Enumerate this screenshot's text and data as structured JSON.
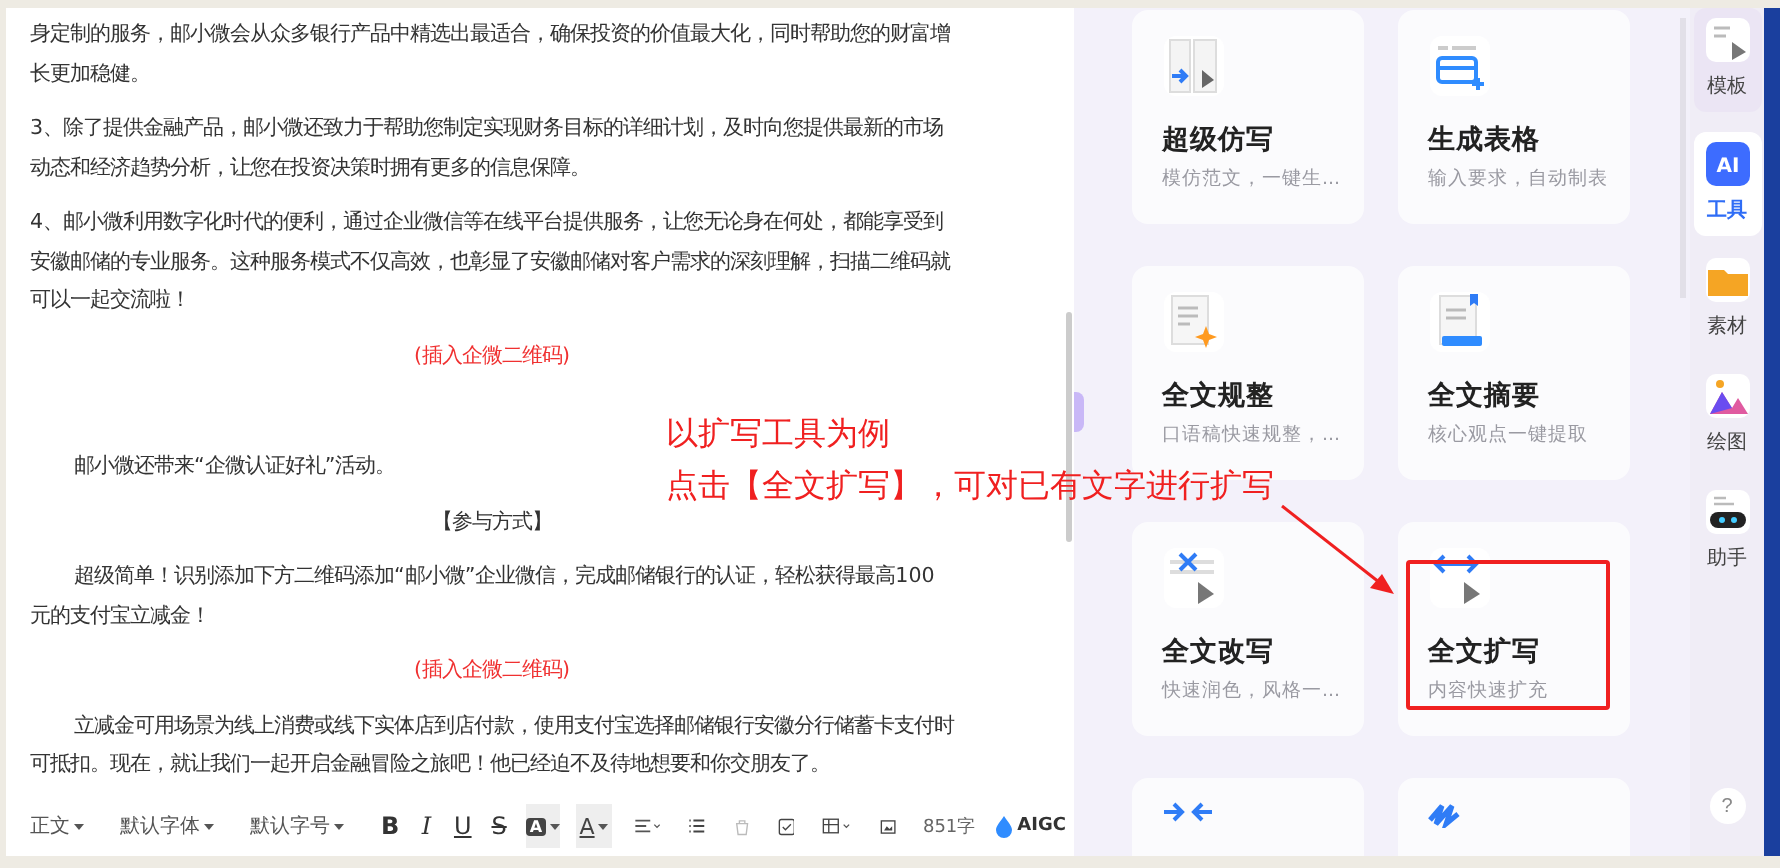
{
  "editor": {
    "paragraphs": [
      {
        "kind": "text",
        "text": "身定制的服务，邮小微会从众多银行产品中精选出最适合，确保投资的价值最大化，同时帮助您的财富增长更加稳健。"
      },
      {
        "kind": "text",
        "text": "3、除了提供金融产品，邮小微还致力于帮助您制定实现财务目标的详细计划，及时向您提供最新的市场动态和经济趋势分析，让您在投资决策时拥有更多的信息保障。"
      },
      {
        "kind": "text",
        "text": "4、邮小微利用数字化时代的便利，通过企业微信等在线平台提供服务，让您无论身在何处，都能享受到安徽邮储的专业服务。这种服务模式不仅高效，也彰显了安徽邮储对客户需求的深刻理解，扫描二维码就可以一起交流啦！"
      },
      {
        "kind": "note",
        "text": "(插入企微二维码)"
      },
      {
        "kind": "indented",
        "text": "邮小微还带来“企微认证好礼”活动。"
      },
      {
        "kind": "centered",
        "text": "【参与方式】"
      },
      {
        "kind": "indented",
        "text": "超级简单！识别添加下方二维码添加“邮小微”企业微信，完成邮储银行的认证，轻松获得最高100元的支付宝立减金！"
      },
      {
        "kind": "note",
        "text": "(插入企微二维码)"
      },
      {
        "kind": "indented",
        "text": "立减金可用场景为线上消费或线下实体店到店付款，使用支付宝选择邮储银行安徽分行储蓄卡支付时可抵扣。现在，就让我们一起开启金融冒险之旅吧！他已经迫不及待地想要和你交朋友了。"
      }
    ]
  },
  "toolbar": [
    {
      "kind": "dropdown",
      "label": "正文"
    },
    {
      "kind": "dropdown",
      "label": "默认字体"
    },
    {
      "kind": "dropdown",
      "label": "默认字号"
    },
    {
      "kind": "bold",
      "label": "B"
    },
    {
      "kind": "italic",
      "label": "I"
    },
    {
      "kind": "underline",
      "label": "U"
    },
    {
      "kind": "strike",
      "label": "S"
    },
    {
      "kind": "highlight",
      "label": "A"
    },
    {
      "kind": "color",
      "label": "A"
    },
    {
      "kind": "align"
    },
    {
      "kind": "list"
    },
    {
      "kind": "eraser"
    },
    {
      "kind": "checkbox"
    },
    {
      "kind": "table"
    },
    {
      "kind": "image"
    },
    {
      "kind": "count",
      "label": "851字"
    },
    {
      "kind": "aigc",
      "label": "AIGC"
    }
  ],
  "tools": [
    {
      "title": "超级仿写",
      "subtitle": "模仿范文，一键生..."
    },
    {
      "title": "生成表格",
      "subtitle": "输入要求，自动制表"
    },
    {
      "title": "全文规整",
      "subtitle": "口语稿快速规整，..."
    },
    {
      "title": "全文摘要",
      "subtitle": "核心观点一键提取"
    },
    {
      "title": "全文改写",
      "subtitle": "快速润色，风格一..."
    },
    {
      "title": "全文扩写",
      "subtitle": "内容快速扩充"
    }
  ],
  "sidebar": [
    {
      "label": "模板",
      "selected": false
    },
    {
      "label": "工具",
      "selected": true,
      "icon_label": "AI"
    },
    {
      "label": "素材",
      "selected": false
    },
    {
      "label": "绘图",
      "selected": false
    },
    {
      "label": "助手",
      "selected": false
    }
  ],
  "help": "?",
  "annotation": {
    "lines": [
      "以扩写工具为例",
      "点击【全文扩写】，可对已有文字进行扩写"
    ]
  }
}
